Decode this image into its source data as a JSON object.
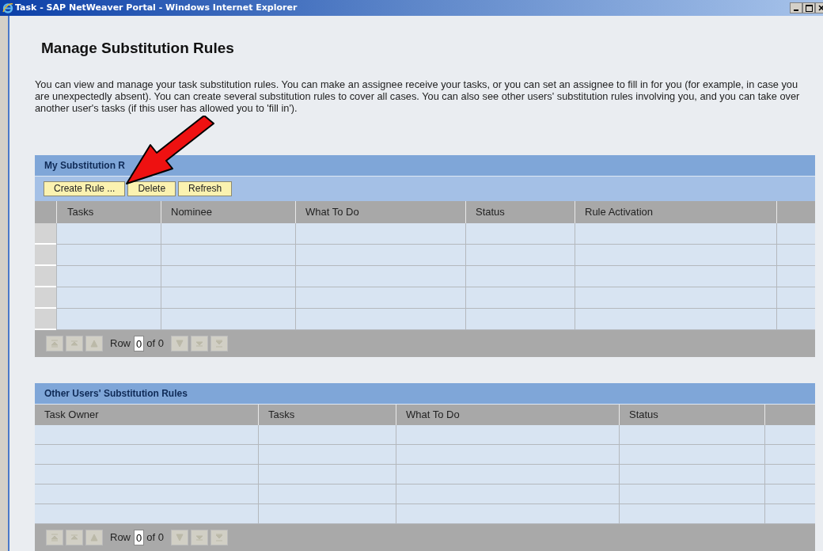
{
  "window": {
    "title": "Task - SAP NetWeaver Portal - Windows Internet Explorer"
  },
  "page": {
    "heading": "Manage Substitution Rules",
    "description": "You can view and manage your task substitution rules. You can make an assignee receive your tasks, or you can set an assignee to fill in for you (for example, in case you are unexpectedly absent). You can create several substitution rules to cover all cases. You can also see other users' substitution rules involving you, and you can take over another user's tasks (if this user has allowed you to 'fill in')."
  },
  "my_rules": {
    "title": "My Substitution R",
    "buttons": [
      "Create Rule ...",
      "Delete",
      "Refresh"
    ],
    "columns": [
      "Tasks",
      "Nominee",
      "What To Do",
      "Status",
      "Rule Activation"
    ],
    "pager": {
      "label": "Row",
      "value": "0",
      "total": "of 0",
      "disabled": true
    }
  },
  "other_rules": {
    "title": "Other Users' Substitution Rules",
    "columns": [
      "Task Owner",
      "Tasks",
      "What To Do",
      "Status"
    ],
    "pager": {
      "label": "Row",
      "value": "0",
      "total": "of 0",
      "disabled": true
    }
  }
}
